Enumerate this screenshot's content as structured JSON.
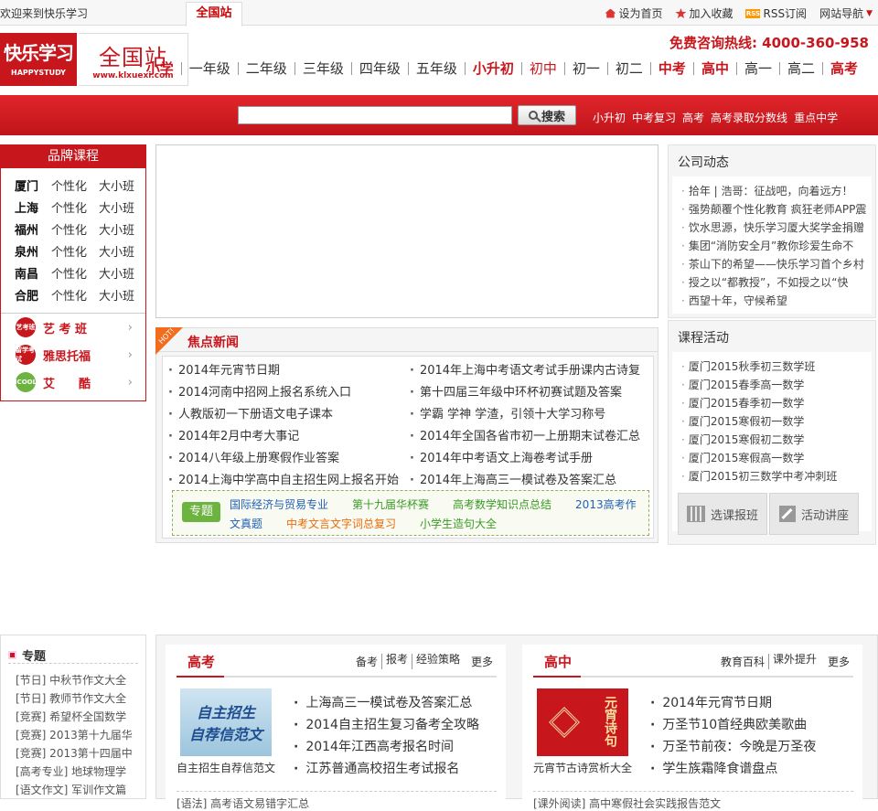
{
  "topbar": {
    "welcome": "欢迎来到快乐学习",
    "station_tab": "全国站",
    "links": [
      "设为首页",
      "加入收藏",
      "RSS订阅",
      "网站导航"
    ]
  },
  "logo": {
    "text": "快乐学习",
    "sub": "HAPPYSTUDY"
  },
  "station": {
    "title": "全国站",
    "url": "www.klxuexi.com"
  },
  "hotline": "免费咨询热线: 4000-360-958",
  "grade_nav": [
    "小学",
    "一年级",
    "二年级",
    "三年级",
    "四年级",
    "五年级",
    "小升初",
    "初中",
    "初一",
    "初二",
    "中考",
    "高中",
    "高一",
    "高二",
    "高考"
  ],
  "search": {
    "button": "搜索",
    "placeholder": ""
  },
  "hot_words": [
    "小升初",
    "中考复习",
    "高考",
    "高考录取分数线",
    "重点中学"
  ],
  "brand": {
    "title": "品牌课程",
    "cities": [
      {
        "name": "厦门",
        "c1": "个性化",
        "c2": "大小班"
      },
      {
        "name": "上海",
        "c1": "个性化",
        "c2": "大小班"
      },
      {
        "name": "福州",
        "c1": "个性化",
        "c2": "大小班"
      },
      {
        "name": "泉州",
        "c1": "个性化",
        "c2": "大小班"
      },
      {
        "name": "南昌",
        "c1": "个性化",
        "c2": "大小班"
      },
      {
        "name": "合肥",
        "c1": "个性化",
        "c2": "大小班"
      }
    ],
    "extras": [
      {
        "label": "艺 考 班",
        "badge": "艺考班"
      },
      {
        "label": "雅思托福",
        "badge": "留学考试"
      },
      {
        "label": "艾　　酷",
        "badge": "ICOOL"
      }
    ]
  },
  "focus": {
    "hot": "HOT!",
    "title": "焦点新闻",
    "news": [
      "2014年元宵节日期",
      "2014年上海中考语文考试手册课内古诗复",
      "2014河南中招网上报名系统入口",
      "第十四届三年级中环杯初赛试题及答案",
      "人教版初一下册语文电子课本",
      "学霸 学神 学渣，引领十大学习称号",
      "2014年2月中考大事记",
      "2014年全国各省市初一上册期末试卷汇总",
      "2014八年级上册寒假作业答案",
      "2014年中考语文上海卷考试手册",
      "2014上海中学高中自主招生网上报名开始",
      "2014年上海高三一模试卷及答案汇总"
    ],
    "topic_label": "专题",
    "topics_row1": [
      {
        "text": "国际经济与贸易专业",
        "color": "#2061b5"
      },
      {
        "text": "第十九届华杯赛",
        "color": "#3a9a24"
      },
      {
        "text": "高考数学知识点总结",
        "color": "#3a9a24"
      },
      {
        "text": "2013高考作",
        "color": "#2061b5"
      }
    ],
    "topics_row2": [
      {
        "text": "文真题",
        "color": "#2061b5"
      },
      {
        "text": "中考文言文字词总复习",
        "color": "#e96c0c"
      },
      {
        "text": "小学生造句大全",
        "color": "#3a9a24"
      }
    ]
  },
  "company_news": {
    "title": "公司动态",
    "items": [
      "拾年 | 浩哥：征战吧，向着远方！",
      "强势颠覆个性化教育 疯狂老师APP震",
      "饮水思源，快乐学习厦大奖学金捐赠",
      "集团“消防安全月”教你珍爱生命不",
      "茶山下的希望——快乐学习首个乡村",
      "授之以“都教授”，不如授之以“快",
      "西望十年，守候希望"
    ]
  },
  "course_activity": {
    "title": "课程活动",
    "items": [
      "厦门2015秋季初三数学班",
      "厦门2015春季高一数学",
      "厦门2015春季初一数学",
      "厦门2015寒假初一数学",
      "厦门2015寒假初二数学",
      "厦门2015寒假高一数学",
      "厦门2015初三数学中考冲刺班"
    ],
    "btn_signup": "选课报班",
    "btn_lecture": "活动讲座"
  },
  "side_topic": {
    "title": "专题",
    "items": [
      "[节日] 中秋节作文大全",
      "[节日] 教师节作文大全",
      "[竞赛] 希望杯全国数学",
      "[竞赛] 2013第十九届华",
      "[竞赛] 2013第十四届中",
      "[高考专业] 地球物理学",
      "[语文作文] 军训作文篇"
    ]
  },
  "gaokao": {
    "title": "高考",
    "links": [
      "备考",
      "报考",
      "经验策略"
    ],
    "more": "更多",
    "img_text": [
      "自主招生",
      "自荐信范文"
    ],
    "caption": "自主招生自荐信范文",
    "news": [
      "上海高三一模试卷及答案汇总",
      "2014自主招生复习备考全攻略",
      "2014年江西高考报名时间",
      "江苏普通高校招生考试报名"
    ],
    "bottom": "[语法] 高考语文易错字汇总"
  },
  "gaozhong": {
    "title": "高中",
    "links": [
      "教育百科",
      "课外提升"
    ],
    "more": "更多",
    "img_text": "元宵诗句",
    "caption": "元宵节古诗赏析大全",
    "news": [
      "2014年元宵节日期",
      "万圣节10首经典欧美歌曲",
      "万圣节前夜：今晚是万圣夜",
      "学生族霜降食谱盘点"
    ],
    "bottom": "[课外阅读] 高中寒假社会实践报告范文"
  }
}
